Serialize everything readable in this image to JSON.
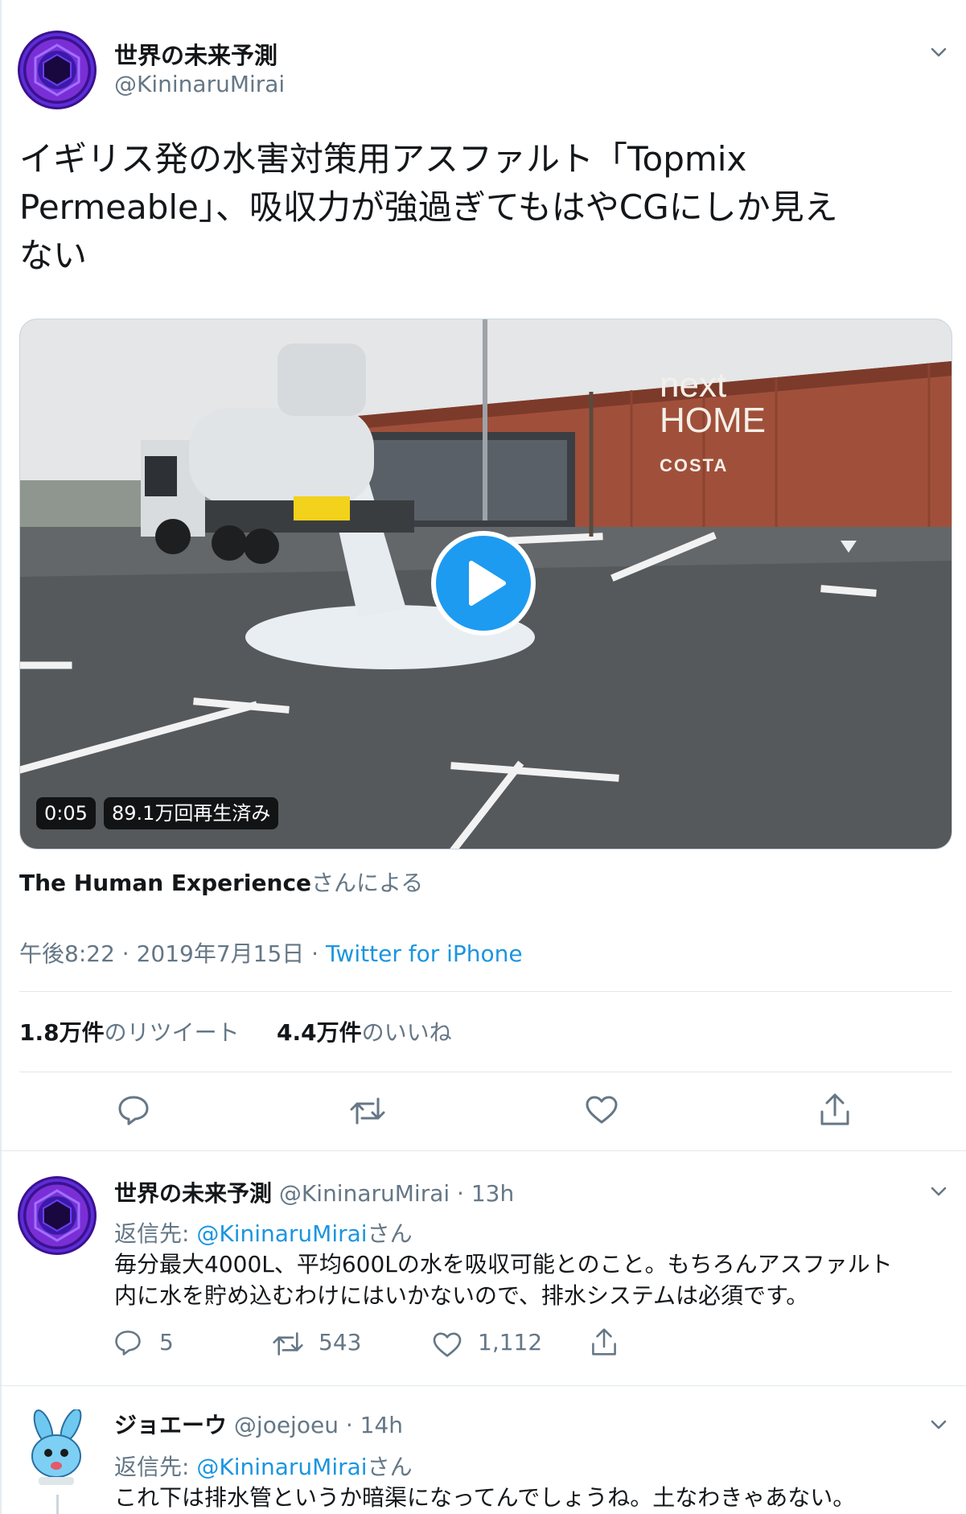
{
  "main_tweet": {
    "display_name": "世界の未来予測",
    "handle": "@KininaruMirai",
    "text_line1": "イギリス発の水害対策用アスファルト「Topmix",
    "text_line2": "Permeable」、吸収力が強過ぎてもはやCGにしか見え",
    "text_line3": "ない",
    "video": {
      "duration": "0:05",
      "views": "89.1万回再生済み",
      "sign_next": "next",
      "sign_home": "HOME",
      "sign_costa": "COSTA"
    },
    "attribution_name": "The Human Experience",
    "attribution_suffix": "さんによる",
    "timestamp": "午後8:22 · 2019年7月15日 · ",
    "source": "Twitter for iPhone",
    "retweets_value": "1.8万件",
    "retweets_suffix": "のリツイート",
    "likes_value": "4.4万件",
    "likes_suffix": "のいいね"
  },
  "reply1": {
    "display_name": "世界の未来予測",
    "handle": "@KininaruMirai",
    "time": "· 13h",
    "reply_to_prefix": "返信先: ",
    "reply_to_handle": "@KininaruMirai",
    "reply_to_suffix": "さん",
    "text_line1": "毎分最大4000L、平均600Lの水を吸収可能とのこと。もちろんアスファルト",
    "text_line2": "内に水を貯め込むわけにはいかないので、排水システムは必須です。",
    "replies": "5",
    "retweets": "543",
    "likes": "1,112"
  },
  "reply2": {
    "display_name": "ジョエーウ",
    "handle": "@joejoeu",
    "time": "· 14h",
    "reply_to_prefix": "返信先: ",
    "reply_to_handle": "@KininaruMirai",
    "reply_to_suffix": "さん",
    "text_line1": "これ下は排水管というか暗渠になってんでしょうね。土なわきゃあない。"
  },
  "colors": {
    "link": "#1b95e0",
    "muted": "#657786",
    "play": "#1d9bf0"
  },
  "icons": [
    "chevron-down-icon",
    "reply-icon",
    "retweet-icon",
    "like-icon",
    "share-icon",
    "play-icon"
  ]
}
